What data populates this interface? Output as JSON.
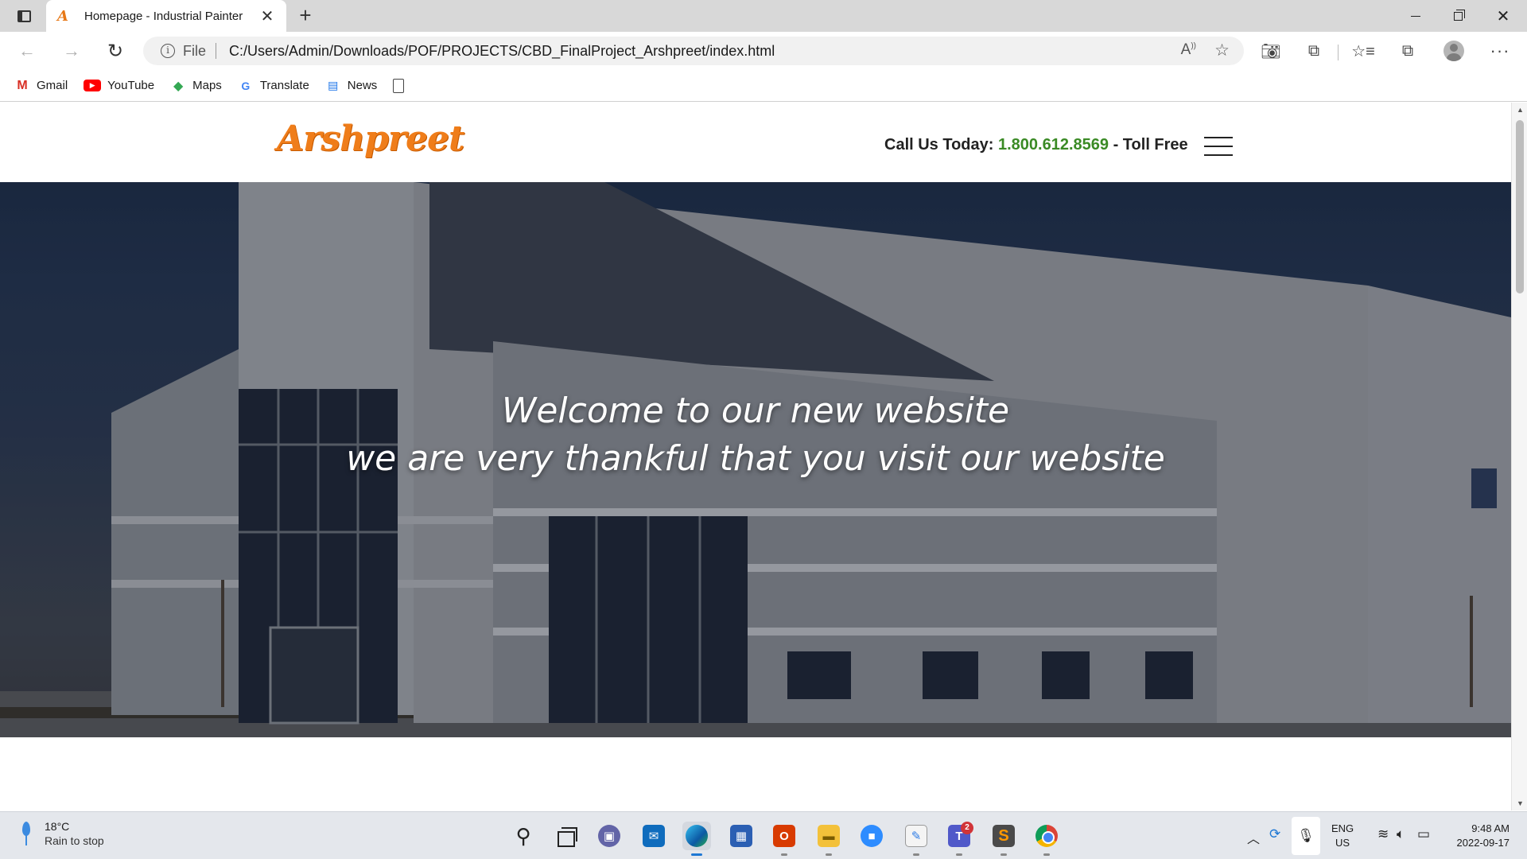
{
  "browser": {
    "tab": {
      "favicon": "A",
      "title": "Homepage - Industrial Painter",
      "close_glyph": "✕"
    },
    "new_tab_glyph": "+",
    "window_controls": {
      "close_glyph": "✕"
    },
    "address_bar": {
      "scheme_label": "File",
      "url": "C:/Users/Admin/Downloads/POF/PROJECTS/CBD_FinalProject_Arshpreet/index.html"
    },
    "icons": {
      "back": "arrow-left-icon",
      "forward": "arrow-right-icon",
      "refresh": "refresh-icon",
      "read_aloud": "read-aloud-icon",
      "add_favorite": "add-favorite-icon",
      "screenshot": "camera-icon",
      "extensions": "puzzle-icon",
      "favorites": "favorites-icon",
      "collections": "collections-icon",
      "profile": "profile-avatar-icon",
      "menu": "more-icon"
    }
  },
  "bookmarks": [
    {
      "label": "Gmail",
      "icon": "gmail-icon"
    },
    {
      "label": "YouTube",
      "icon": "youtube-icon"
    },
    {
      "label": "Maps",
      "icon": "maps-icon"
    },
    {
      "label": "Translate",
      "icon": "translate-icon"
    },
    {
      "label": "News",
      "icon": "news-icon"
    }
  ],
  "site": {
    "logo": "Arshpreet",
    "call_us_prefix": "Call Us Today:",
    "phone": "1.800.612.8569",
    "call_us_suffix": "- Toll Free",
    "hero": {
      "line1": "Welcome to our new website",
      "line2": "we are very thankful that you visit our website"
    },
    "colors": {
      "logo": "#ef7d1a",
      "phone": "#3a8a25"
    }
  },
  "taskbar": {
    "weather": {
      "temp": "18°C",
      "desc": "Rain to stop"
    },
    "teams_badge": "2",
    "tray": {
      "lang_line1": "ENG",
      "lang_line2": "US"
    },
    "clock": {
      "time": "9:48 AM",
      "date": "2022-09-17"
    }
  }
}
